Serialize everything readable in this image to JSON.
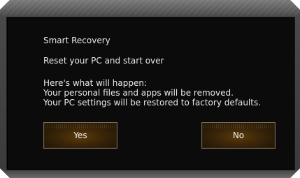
{
  "dialog": {
    "heading": "Smart Recovery",
    "subtitle": "Reset your PC and start over",
    "body_lines": [
      "Here's what will happen:",
      "Your personal files and apps will be removed.",
      "Your PC settings will be restored to factory defaults."
    ],
    "buttons": {
      "yes_label": "Yes",
      "no_label": "No"
    }
  },
  "colors": {
    "background": "#0b0b0b",
    "text": "#e8e8e8",
    "button_accent": "#5a3b0b"
  }
}
